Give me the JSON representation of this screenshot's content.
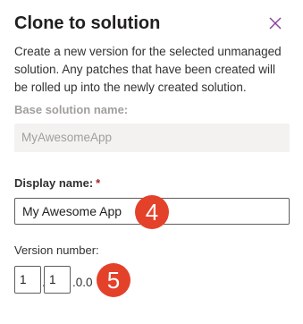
{
  "dialog": {
    "title": "Clone to solution",
    "close_icon": "close-icon",
    "description": "Create a new version for the selected unmanaged solution. Any patches that have been created will be rolled up into the newly created solution."
  },
  "base_solution": {
    "label": "Base solution name:",
    "value": "MyAwesomeApp"
  },
  "display_name": {
    "label": "Display name:",
    "required_marker": "*",
    "value": "My Awesome App"
  },
  "version": {
    "label": "Version number:",
    "major": "1",
    "minor": "1",
    "separator": ".",
    "suffix": ".0.0"
  },
  "badges": {
    "step_4": "4",
    "step_5": "5",
    "color": "#e4412b"
  }
}
